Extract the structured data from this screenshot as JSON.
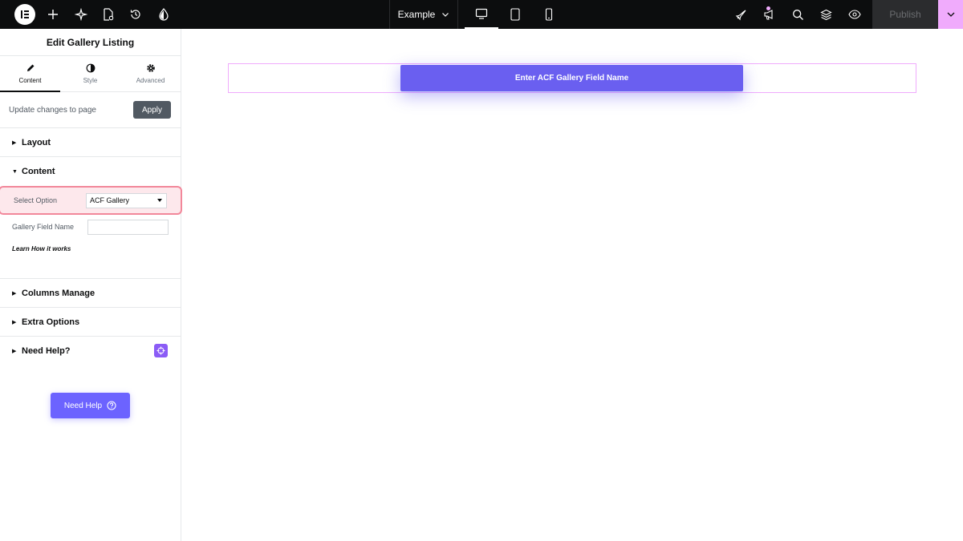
{
  "topbar": {
    "document_title": "Example",
    "publish_label": "Publish",
    "icons": [
      "elementor-logo-icon",
      "add-icon",
      "ai-sparkle-icon",
      "page-settings-icon",
      "history-icon",
      "theme-style-icon",
      "desktop-icon",
      "tablet-icon",
      "mobile-icon",
      "rocket-icon",
      "megaphone-icon",
      "search-icon",
      "layers-icon",
      "preview-eye-icon",
      "chevron-down-icon"
    ],
    "accent_color": "#f0abfc"
  },
  "panel": {
    "title": "Edit Gallery Listing",
    "tabs": [
      {
        "label": "Content",
        "icon": "pencil-icon",
        "active": true
      },
      {
        "label": "Style",
        "icon": "half-circle-icon",
        "active": false
      },
      {
        "label": "Advanced",
        "icon": "gear-icon",
        "active": false
      }
    ],
    "apply_text": "Update changes to page",
    "apply_label": "Apply",
    "sections": {
      "layout": "Layout",
      "content": "Content",
      "columns": "Columns Manage",
      "extra": "Extra Options",
      "help": "Need Help?"
    },
    "controls": {
      "select_option_label": "Select Option",
      "select_option_value": "ACF Gallery",
      "gallery_field_label": "Gallery Field Name",
      "gallery_field_value": ""
    },
    "learn_link": "Learn How it works",
    "need_help_button": "Need Help"
  },
  "canvas": {
    "placeholder_label": "Enter ACF Gallery Field Name",
    "button_color": "#6a5ff0"
  }
}
